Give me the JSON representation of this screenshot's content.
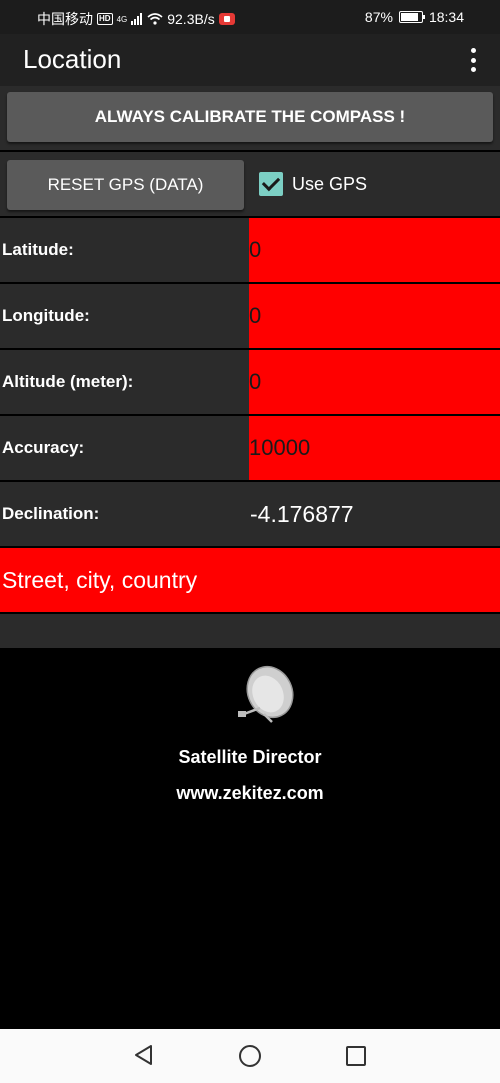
{
  "status_bar": {
    "carrier": "中国移动",
    "hd": "HD",
    "network": "4G",
    "speed": "92.3B/s",
    "battery_pct": "87%",
    "battery_level": 0.87,
    "time": "18:34"
  },
  "app_bar": {
    "title": "Location"
  },
  "calibrate_button": "ALWAYS CALIBRATE THE COMPASS !",
  "gps": {
    "reset_button": "RESET GPS (DATA)",
    "use_gps_label": "Use GPS",
    "use_gps_checked": true
  },
  "rows": {
    "latitude": {
      "label": "Latitude:",
      "value": "0"
    },
    "longitude": {
      "label": "Longitude:",
      "value": "0"
    },
    "altitude": {
      "label": "Altitude (meter):",
      "value": "0"
    },
    "accuracy": {
      "label": "Accuracy:",
      "value": "10000"
    },
    "declination": {
      "label": "Declination:",
      "value": "-4.176877"
    }
  },
  "address_placeholder": "Street, city, country",
  "branding": {
    "name": "Satellite Director",
    "url": "www.zekitez.com",
    "icon": "satellite-dish-icon"
  },
  "colors": {
    "alert_red": "#ff0000",
    "checkbox_teal": "#7ccfc4",
    "panel_bg": "#2b2b2b",
    "button_bg": "#5a5a5a"
  }
}
